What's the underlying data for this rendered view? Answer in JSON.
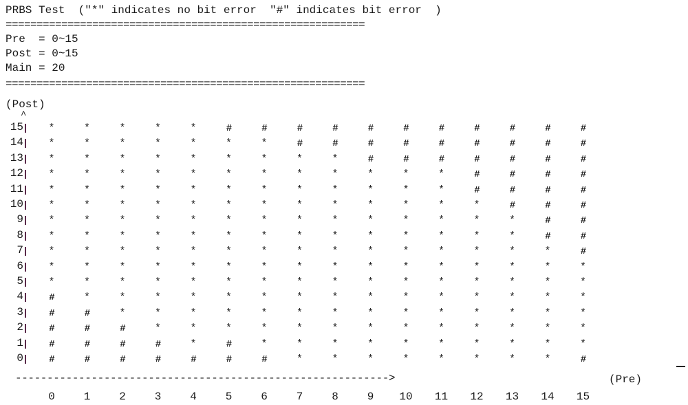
{
  "header": {
    "title": "PRBS Test  (\"*\" indicates no bit error  \"#\" indicates bit error  )",
    "separator": "=========================================================="
  },
  "params": [
    {
      "text": "Pre  = 0~15"
    },
    {
      "text": "Post = 0~15"
    },
    {
      "text": "Main = 20"
    }
  ],
  "axes": {
    "y_label": "(Post)",
    "y_caret": "^",
    "x_label": "(Pre)",
    "x_line": "----------------------------------------------------------->"
  },
  "legend": {
    "ok_symbol": "*",
    "ok_meaning": "no bit error",
    "error_symbol": "#",
    "error_meaning": "bit error"
  },
  "chart_data": {
    "type": "heatmap",
    "title": "PRBS Test",
    "xlabel": "Pre",
    "ylabel": "Post",
    "main": 20,
    "x": [
      0,
      1,
      2,
      3,
      4,
      5,
      6,
      7,
      8,
      9,
      10,
      11,
      12,
      13,
      14,
      15
    ],
    "y": [
      15,
      14,
      13,
      12,
      11,
      10,
      9,
      8,
      7,
      6,
      5,
      4,
      3,
      2,
      1,
      0
    ],
    "rows": [
      {
        "post": 15,
        "cells": "*****###########"
      },
      {
        "post": 14,
        "cells": "*******#########"
      },
      {
        "post": 13,
        "cells": "*********#######"
      },
      {
        "post": 12,
        "cells": "************####"
      },
      {
        "post": 11,
        "cells": "************####"
      },
      {
        "post": 10,
        "cells": "*************###"
      },
      {
        "post": 9,
        "cells": "**************##"
      },
      {
        "post": 8,
        "cells": "**************##"
      },
      {
        "post": 7,
        "cells": "***************#"
      },
      {
        "post": 6,
        "cells": "****************"
      },
      {
        "post": 5,
        "cells": "****************"
      },
      {
        "post": 4,
        "cells": "#***************"
      },
      {
        "post": 3,
        "cells": "##**************"
      },
      {
        "post": 2,
        "cells": "###*************"
      },
      {
        "post": 1,
        "cells": "####*#**********"
      },
      {
        "post": 0,
        "cells": "#######********#"
      }
    ],
    "legend": {
      "*": "no bit error",
      "#": "bit error"
    }
  },
  "colors": {
    "text": "#1a1a1a",
    "axis_bar": "#5a2a4a",
    "background": "#ffffff"
  }
}
